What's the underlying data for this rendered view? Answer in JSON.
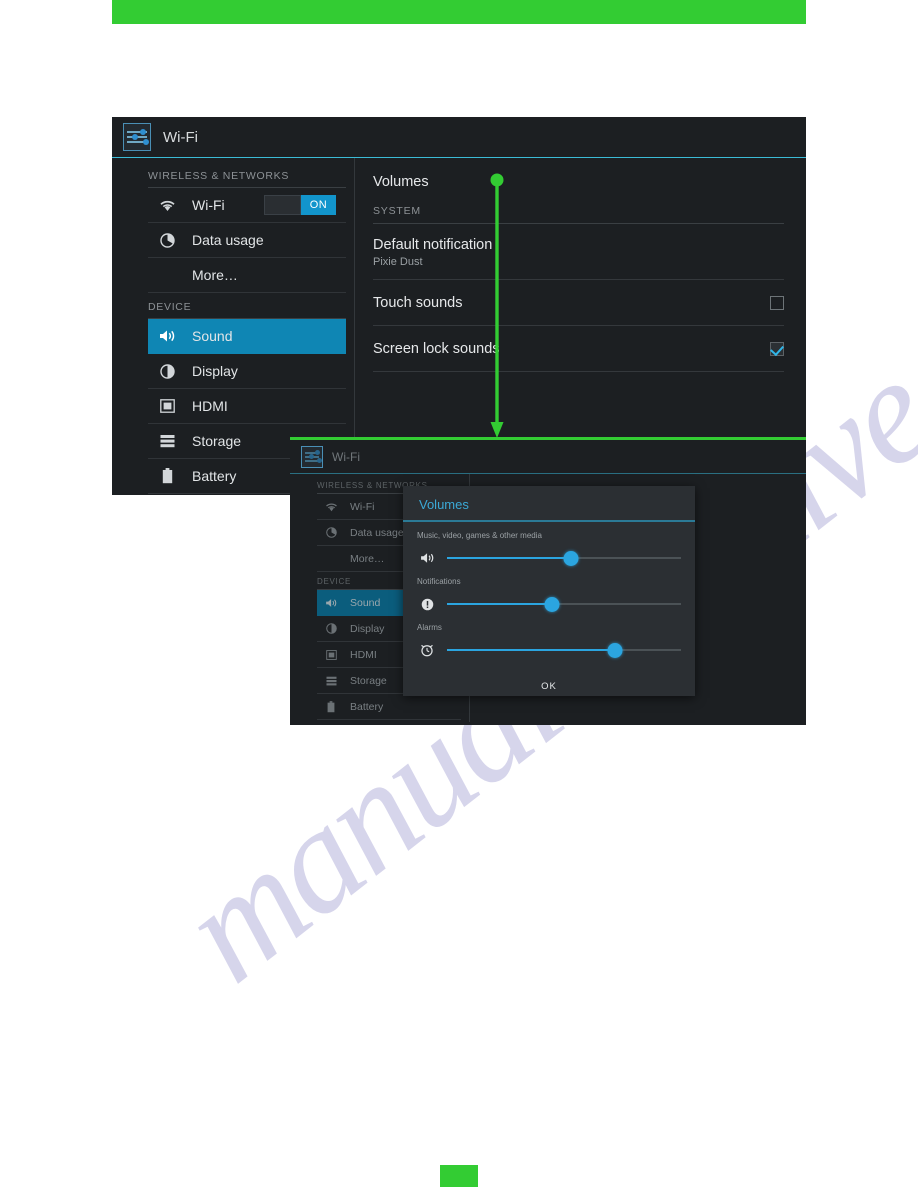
{
  "page": {
    "watermark": "manualsarchive.com"
  },
  "panel_one": {
    "header": {
      "icon": "settings-sliders-icon",
      "title": "Wi-Fi"
    },
    "sidebar": {
      "groups": [
        {
          "label": "WIRELESS & NETWORKS",
          "items": [
            {
              "label": "Wi-Fi",
              "icon": "wifi-icon",
              "toggle": "ON",
              "selected": false
            },
            {
              "label": "Data usage",
              "icon": "data-usage-icon",
              "selected": false
            },
            {
              "label": "More…",
              "icon": "",
              "selected": false
            }
          ]
        },
        {
          "label": "DEVICE",
          "items": [
            {
              "label": "Sound",
              "icon": "volume-icon",
              "selected": true
            },
            {
              "label": "Display",
              "icon": "brightness-icon",
              "selected": false
            },
            {
              "label": "HDMI",
              "icon": "hdmi-icon",
              "selected": false
            },
            {
              "label": "Storage",
              "icon": "storage-icon",
              "selected": false
            },
            {
              "label": "Battery",
              "icon": "battery-icon",
              "selected": false
            }
          ]
        }
      ]
    },
    "main": {
      "volumes_row": "Volumes",
      "section_label": "SYSTEM",
      "rows": [
        {
          "title": "Default notification",
          "sub": "Pixie Dust",
          "control": "none"
        },
        {
          "title": "Touch sounds",
          "sub": "",
          "control": "checkbox-unchecked"
        },
        {
          "title": "Screen lock sounds",
          "sub": "",
          "control": "checkbox-checked"
        }
      ]
    }
  },
  "panel_two": {
    "header": {
      "icon": "settings-sliders-icon",
      "title": "Wi-Fi"
    },
    "sidebar": {
      "groups": [
        {
          "label": "WIRELESS & NETWORKS",
          "items": [
            {
              "label": "Wi-Fi",
              "icon": "wifi-icon",
              "selected": false
            },
            {
              "label": "Data usage",
              "icon": "data-usage-icon",
              "selected": false
            },
            {
              "label": "More…",
              "icon": "",
              "selected": false
            }
          ]
        },
        {
          "label": "DEVICE",
          "items": [
            {
              "label": "Sound",
              "icon": "volume-icon",
              "selected": true
            },
            {
              "label": "Display",
              "icon": "brightness-icon",
              "selected": false
            },
            {
              "label": "HDMI",
              "icon": "hdmi-icon",
              "selected": false
            },
            {
              "label": "Storage",
              "icon": "storage-icon",
              "selected": false
            },
            {
              "label": "Battery",
              "icon": "battery-icon",
              "selected": false
            }
          ]
        }
      ]
    },
    "dialog": {
      "title": "Volumes",
      "sliders": [
        {
          "label": "Music, video, games & other media",
          "icon": "volume-icon",
          "value": 53
        },
        {
          "label": "Notifications",
          "icon": "notification-icon",
          "value": 45
        },
        {
          "label": "Alarms",
          "icon": "alarm-clock-icon",
          "value": 72
        }
      ],
      "ok_label": "OK"
    }
  },
  "colors": {
    "accent_green": "#33cc33",
    "accent_blue": "#0f86b4",
    "slider_blue": "#2ba5e0",
    "panel_bg": "#1c1f22"
  }
}
